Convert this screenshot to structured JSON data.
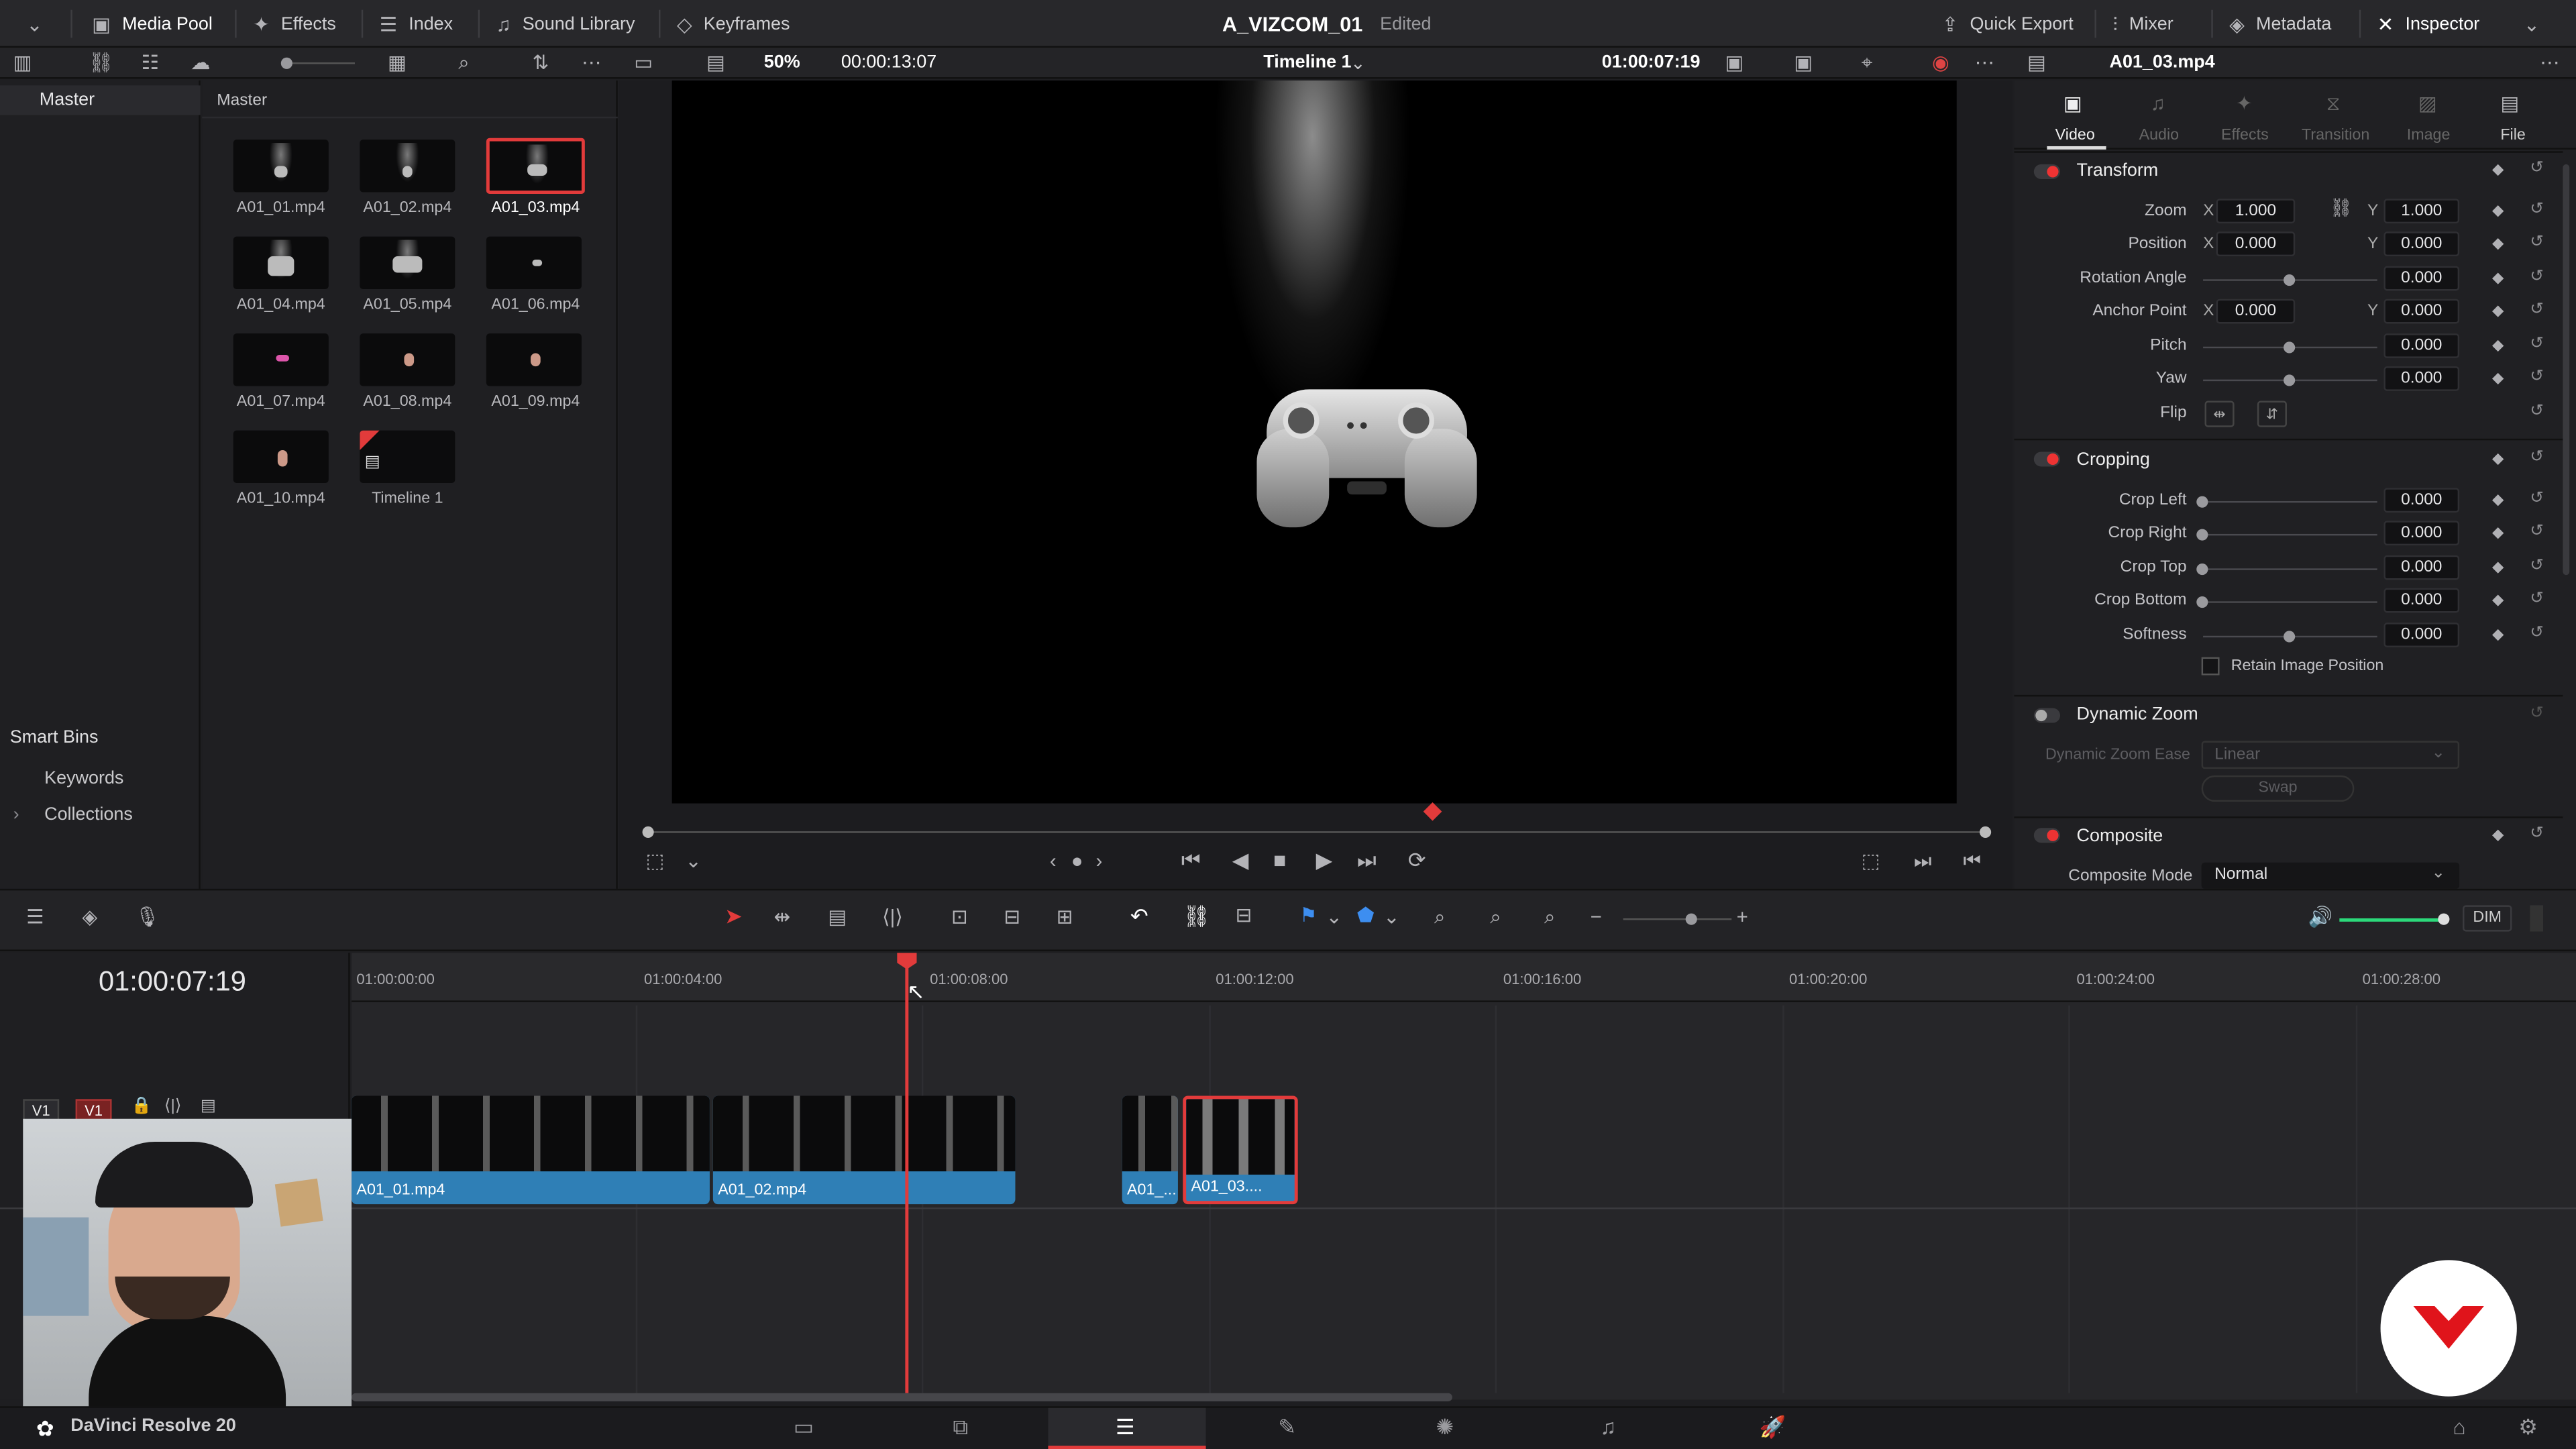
{
  "topbar": {
    "media_pool": "Media Pool",
    "effects": "Effects",
    "index": "Index",
    "sound_library": "Sound Library",
    "keyframes": "Keyframes",
    "project_name": "A_VIZCOM_01",
    "project_status": "Edited",
    "quick_export": "Quick Export",
    "mixer": "Mixer",
    "metadata": "Metadata",
    "inspector": "Inspector"
  },
  "viewer_bar": {
    "zoom": "50%",
    "source_timecode": "00:00:13:07",
    "timeline_name": "Timeline 1",
    "record_timecode": "01:00:07:19",
    "clip_name": "A01_03.mp4"
  },
  "bins": {
    "master_label": "Master",
    "smart_bins": "Smart Bins",
    "keywords": "Keywords",
    "collections": "Collections"
  },
  "media_pool": {
    "header": "Master",
    "items": [
      "A01_01.mp4",
      "A01_02.mp4",
      "A01_03.mp4",
      "A01_04.mp4",
      "A01_05.mp4",
      "A01_06.mp4",
      "A01_07.mp4",
      "A01_08.mp4",
      "A01_09.mp4",
      "A01_10.mp4",
      "Timeline 1"
    ]
  },
  "inspector": {
    "tabs": [
      "Video",
      "Audio",
      "Effects",
      "Transition",
      "Image",
      "File"
    ],
    "transform": {
      "title": "Transform",
      "zoom_label": "Zoom",
      "zoom_x": "1.000",
      "zoom_y": "1.000",
      "position_label": "Position",
      "position_x": "0.000",
      "position_y": "0.000",
      "rotation_label": "Rotation Angle",
      "rotation": "0.000",
      "anchor_label": "Anchor Point",
      "anchor_x": "0.000",
      "anchor_y": "0.000",
      "pitch_label": "Pitch",
      "pitch": "0.000",
      "yaw_label": "Yaw",
      "yaw": "0.000",
      "flip_label": "Flip",
      "x": "X",
      "y": "Y"
    },
    "cropping": {
      "title": "Cropping",
      "left_label": "Crop Left",
      "left": "0.000",
      "right_label": "Crop Right",
      "right": "0.000",
      "top_label": "Crop Top",
      "top": "0.000",
      "bottom_label": "Crop Bottom",
      "bottom": "0.000",
      "softness_label": "Softness",
      "softness": "0.000",
      "retain": "Retain Image Position"
    },
    "dynamic_zoom": {
      "title": "Dynamic Zoom",
      "ease_label": "Dynamic Zoom Ease",
      "ease_value": "Linear",
      "swap": "Swap"
    },
    "composite": {
      "title": "Composite",
      "mode_label": "Composite Mode",
      "mode_value": "Normal"
    }
  },
  "timeline": {
    "timecode": "01:00:07:19",
    "ruler": [
      "01:00:00:00",
      "01:00:04:00",
      "01:00:08:00",
      "01:00:12:00",
      "01:00:16:00",
      "01:00:20:00",
      "01:00:24:00",
      "01:00:28:00"
    ],
    "track_v1": "V1",
    "clips": [
      "A01_01.mp4",
      "A01_02.mp4",
      "A01_...",
      "A01_03...."
    ],
    "dim": "DIM"
  },
  "footer": {
    "app_name": "DaVinci Resolve 20"
  },
  "colors": {
    "accent_red": "#e23b3b",
    "clip_blue": "#2f7fb6"
  }
}
